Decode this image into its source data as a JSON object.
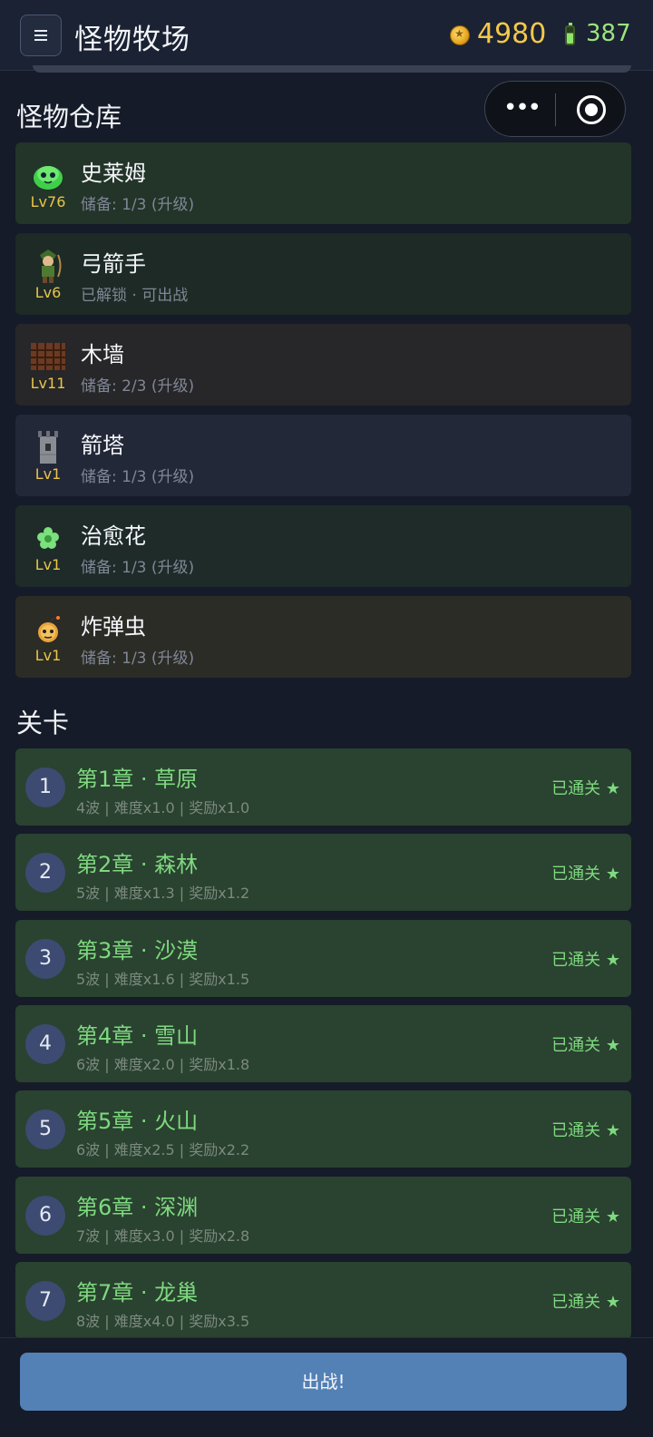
{
  "header": {
    "menu_glyph": "≡",
    "title": "怪物牧场",
    "coins": "4980",
    "energy": "387"
  },
  "capsule": {
    "more_glyph": "•••"
  },
  "warehouse": {
    "title": "怪物仓库",
    "monsters": [
      {
        "name": "史莱姆",
        "level": "Lv76",
        "status": "储备: 1/3 (升级)",
        "icon": "slime-icon",
        "bg": "#233429"
      },
      {
        "name": "弓箭手",
        "level": "Lv6",
        "status": "已解锁 · 可出战",
        "icon": "archer-icon",
        "bg": "#1e2a25"
      },
      {
        "name": "木墙",
        "level": "Lv11",
        "status": "储备: 2/3 (升级)",
        "icon": "wood-wall-icon",
        "bg": "#272628"
      },
      {
        "name": "箭塔",
        "level": "Lv1",
        "status": "储备: 1/3 (升级)",
        "icon": "arrow-tower-icon",
        "bg": "#232838"
      },
      {
        "name": "治愈花",
        "level": "Lv1",
        "status": "储备: 1/3 (升级)",
        "icon": "heal-flower-icon",
        "bg": "#1e2b29"
      },
      {
        "name": "炸弹虫",
        "level": "Lv1",
        "status": "储备: 1/3 (升级)",
        "icon": "bomb-bug-icon",
        "bg": "#2c2c26"
      }
    ]
  },
  "levels": {
    "title": "关卡",
    "items": [
      {
        "num": "1",
        "title": "第1章 · 草原",
        "info": "4波 | 难度x1.0 | 奖励x1.0",
        "status": "已通关 ★"
      },
      {
        "num": "2",
        "title": "第2章 · 森林",
        "info": "5波 | 难度x1.3 | 奖励x1.2",
        "status": "已通关 ★"
      },
      {
        "num": "3",
        "title": "第3章 · 沙漠",
        "info": "5波 | 难度x1.6 | 奖励x1.5",
        "status": "已通关 ★"
      },
      {
        "num": "4",
        "title": "第4章 · 雪山",
        "info": "6波 | 难度x2.0 | 奖励x1.8",
        "status": "已通关 ★"
      },
      {
        "num": "5",
        "title": "第5章 · 火山",
        "info": "6波 | 难度x2.5 | 奖励x2.2",
        "status": "已通关 ★"
      },
      {
        "num": "6",
        "title": "第6章 · 深渊",
        "info": "7波 | 难度x3.0 | 奖励x2.8",
        "status": "已通关 ★"
      },
      {
        "num": "7",
        "title": "第7章 · 龙巢",
        "info": "8波 | 难度x4.0 | 奖励x3.5",
        "status": "已通关 ★"
      }
    ]
  },
  "footer": {
    "battle_label": "出战!"
  }
}
